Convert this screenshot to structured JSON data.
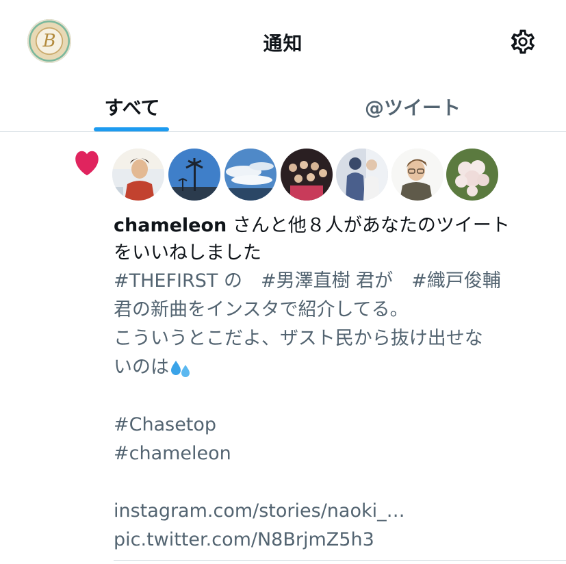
{
  "header": {
    "title": "通知",
    "profile_monogram": "B",
    "settings_icon": "gear-icon"
  },
  "tabs": [
    {
      "label": "すべて",
      "selected": true
    },
    {
      "label": "@ツイート",
      "selected": false
    }
  ],
  "colors": {
    "accent": "#1d9bf0",
    "like": "#f91880",
    "secondary_text": "#536471",
    "divider": "#cfd9de"
  },
  "notification": {
    "type_icon": "heart-icon",
    "liker_avatars": [
      "avatar-man-red-shirt",
      "avatar-palm-trees",
      "avatar-sky-clouds",
      "avatar-group-photo",
      "avatar-two-people",
      "avatar-man-glasses",
      "avatar-white-flowers"
    ],
    "user": "chameleon",
    "message_rest_line1": " さんと他８人があなたのツイート",
    "message_line2": "をいいねしました",
    "tweet_lines": [
      "#THEFIRST の　#男澤直樹 君が　#織戸俊輔",
      "君の新曲をインスタで紹介してる。",
      "こういうとこだよ、ザスト民から抜け出せな",
      "いのは"
    ],
    "emoji_icon": "sweat-droplets-icon",
    "hashtags": [
      "#Chasetop",
      "#chameleon"
    ],
    "links": [
      "instagram.com/stories/naoki_…",
      "pic.twitter.com/N8BrjmZ5h3"
    ]
  }
}
